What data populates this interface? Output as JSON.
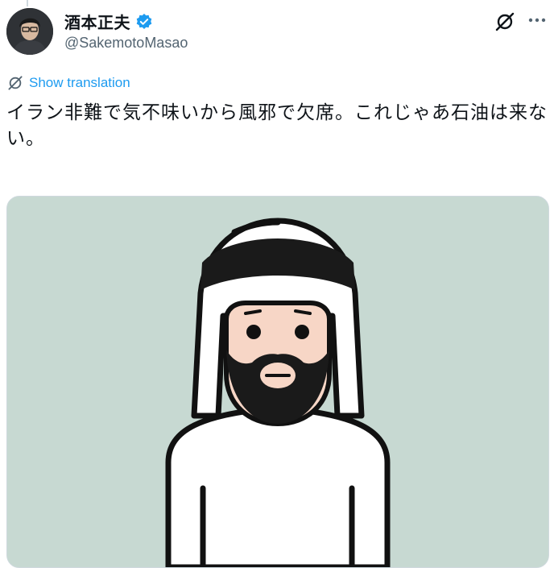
{
  "author": {
    "display_name": "酒本正夫",
    "handle": "@SakemotoMasao",
    "verified": true
  },
  "translate": {
    "label": "Show translation"
  },
  "tweet": {
    "text": "イラン非難で気不味いから風邪で欠席。これじゃあ石油は来ない。"
  },
  "media": {
    "illustration": "cartoon man in white keffiyeh with black agal"
  },
  "icons": {
    "grok": "grok-icon",
    "more": "more-icon",
    "translate": "grok-translate-icon",
    "verified": "verified-badge-icon"
  },
  "colors": {
    "accent": "#1d9bf0",
    "media_bg": "#c7d9d2",
    "secondary_text": "#536471"
  }
}
